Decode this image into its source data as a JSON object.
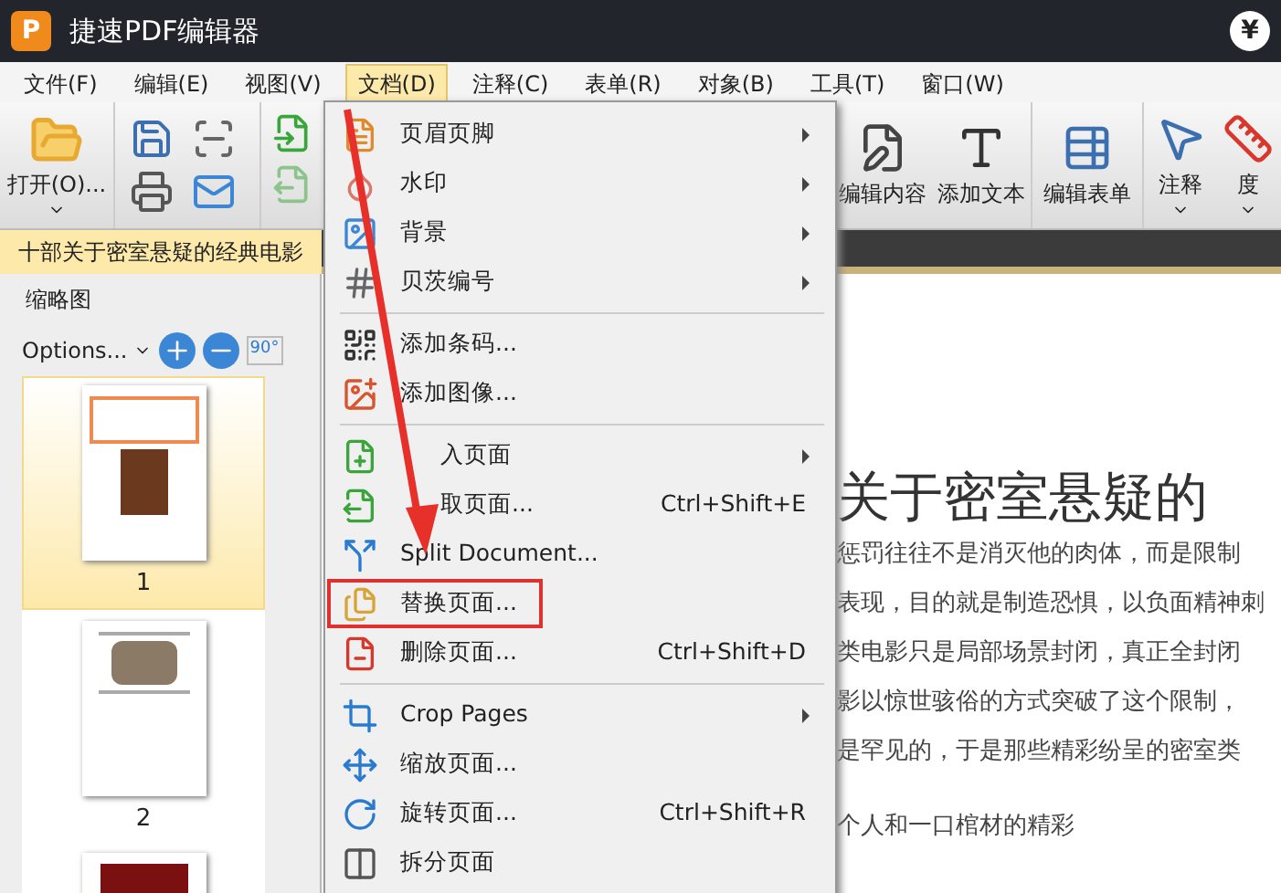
{
  "window": {
    "logo": "P",
    "title": "捷速PDF编辑器",
    "badge": "¥"
  },
  "menu_bar": [
    {
      "label": "文件(F)",
      "selected": false
    },
    {
      "label": "编辑(E)",
      "selected": false
    },
    {
      "label": "视图(V)",
      "selected": false
    },
    {
      "label": "文档(D)",
      "selected": true
    },
    {
      "label": "注释(C)",
      "selected": false
    },
    {
      "label": "表单(R)",
      "selected": false
    },
    {
      "label": "对象(B)",
      "selected": false
    },
    {
      "label": "工具(T)",
      "selected": false
    },
    {
      "label": "窗口(W)",
      "selected": false
    }
  ],
  "toolbar": {
    "open_button": {
      "label": "打开(O)..."
    },
    "tools": [
      {
        "kind": "edit-content",
        "label": "编辑内容",
        "has_dropdown": false
      },
      {
        "kind": "add-text",
        "label": "添加文本",
        "has_dropdown": false
      },
      {
        "kind": "edit-form",
        "label": "编辑表单",
        "has_dropdown": false
      },
      {
        "kind": "annotate",
        "label": "注释",
        "has_dropdown": true
      },
      {
        "kind": "measure",
        "label": "度",
        "has_dropdown": true
      }
    ]
  },
  "document_tab": {
    "label": "十部关于密室悬疑的经典电影"
  },
  "thumbnails_panel": {
    "title": "缩略图",
    "options": "Options...",
    "rotate_label": "90°",
    "pages": [
      {
        "kind": "cover",
        "label": "1",
        "selected": true
      },
      {
        "kind": "figure",
        "label": "2",
        "selected": false
      },
      {
        "kind": "poster",
        "selected": false
      }
    ]
  },
  "document": {
    "title": "关于密室悬疑的",
    "lines": [
      "惩罚往往不是消灭他的肉体，而是限制",
      "表现，目的就是制造恐惧，以负面精神刺",
      "类电影只是局部场景封闭，真正全封闭",
      "影以惊世骇俗的方式突破了这个限制，",
      "是罕见的，于是那些精彩纷呈的密室类"
    ],
    "last_line": "个人和一口棺材的精彩"
  },
  "dropdown_menu": {
    "items": [
      {
        "kind": "item",
        "label": "页眉页脚",
        "submenu": true,
        "highlighted": false
      },
      {
        "kind": "item",
        "label": "水印",
        "submenu": true,
        "highlighted": false
      },
      {
        "kind": "item",
        "label": "背景",
        "submenu": true,
        "highlighted": false
      },
      {
        "kind": "item",
        "label": "贝茨编号",
        "submenu": true,
        "highlighted": false
      },
      {
        "kind": "separator"
      },
      {
        "kind": "item",
        "label": "添加条码...",
        "submenu": false,
        "highlighted": false
      },
      {
        "kind": "item",
        "label": "添加图像...",
        "submenu": false,
        "highlighted": false
      },
      {
        "kind": "separator"
      },
      {
        "kind": "item",
        "label": "入页面",
        "submenu": true,
        "highlighted": false
      },
      {
        "kind": "item",
        "label": "取页面...",
        "shortcut": "Ctrl+Shift+E",
        "submenu": false,
        "highlighted": false
      },
      {
        "kind": "item",
        "label": "Split Document...",
        "submenu": false,
        "highlighted": false
      },
      {
        "kind": "item",
        "label": "替换页面...",
        "submenu": false,
        "highlighted": true
      },
      {
        "kind": "item",
        "label": "删除页面...",
        "shortcut": "Ctrl+Shift+D",
        "submenu": false,
        "highlighted": false
      },
      {
        "kind": "separator"
      },
      {
        "kind": "item",
        "label": "Crop Pages",
        "submenu": true,
        "highlighted": false
      },
      {
        "kind": "item",
        "label": "缩放页面...",
        "submenu": false,
        "highlighted": false
      },
      {
        "kind": "item",
        "label": "旋转页面...",
        "shortcut": "Ctrl+Shift+R",
        "submenu": false,
        "highlighted": false
      },
      {
        "kind": "item",
        "label": "拆分页面",
        "submenu": false,
        "highlighted": false
      }
    ]
  }
}
